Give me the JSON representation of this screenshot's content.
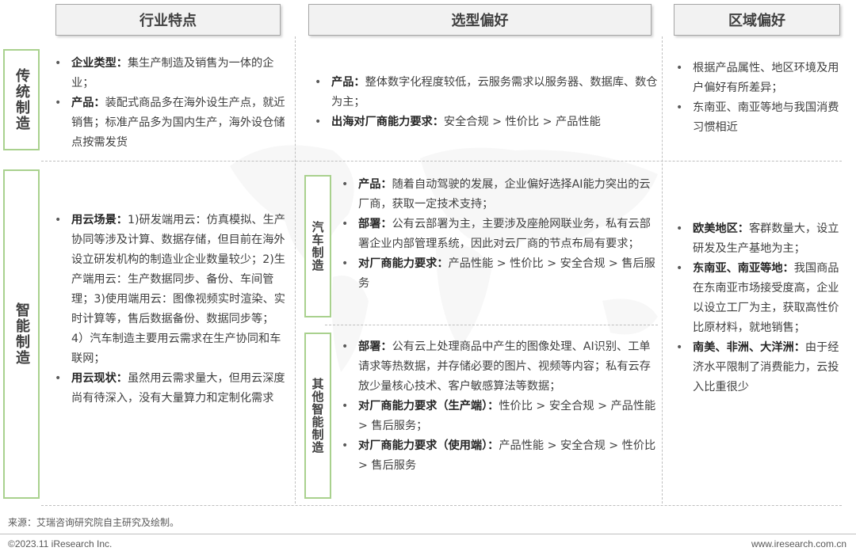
{
  "columns": {
    "industry": "行业特点",
    "preference": "选型偏好",
    "region": "区域偏好"
  },
  "rows": {
    "traditional": "传统制造",
    "smart": "智能制造"
  },
  "sub_rows": {
    "auto": "汽车制造",
    "other": "其他智能制造"
  },
  "traditional": {
    "industry": [
      {
        "label": "企业类型：",
        "text": "集生产制造及销售为一体的企业；"
      },
      {
        "label": "产品：",
        "text": "装配式商品多在海外设生产点，就近销售；标准产品多为国内生产，海外设仓储点按需发货"
      }
    ],
    "preference": [
      {
        "label": "产品：",
        "text": "整体数字化程度较低，云服务需求以服务器、数据库、数仓为主；"
      },
      {
        "label": "出海对厂商能力要求：",
        "text": "安全合规 > 性价比 > 产品性能"
      }
    ],
    "region": [
      {
        "text": "根据产品属性、地区环境及用户偏好有所差异；"
      },
      {
        "text": "东南亚、南亚等地与我国消费习惯相近"
      }
    ]
  },
  "smart": {
    "industry": [
      {
        "label": "用云场景：",
        "text": "1)研发端用云：仿真模拟、生产协同等涉及计算、数据存储，但目前在海外设立研发机构的制造业企业数量较少；2)生产端用云：生产数据同步、备份、车间管理；3)使用端用云：图像视频实时渲染、实时计算等，售后数据备份、数据同步等；4）汽车制造主要用云需求在生产协同和车联网；"
      },
      {
        "label": "用云现状：",
        "text": "虽然用云需求量大，但用云深度尚有待深入，没有大量算力和定制化需求"
      }
    ],
    "auto_preference": [
      {
        "label": "产品：",
        "text": "随着自动驾驶的发展，企业偏好选择AI能力突出的云厂商，获取一定技术支持；"
      },
      {
        "label": "部署：",
        "text": "公有云部署为主，主要涉及座舱网联业务，私有云部署企业内部管理系统，因此对云厂商的节点布局有要求；"
      },
      {
        "label": "对厂商能力要求：",
        "text": "产品性能 > 性价比 > 安全合规 > 售后服务"
      }
    ],
    "other_preference": [
      {
        "label": "部署：",
        "text": "公有云上处理商品中产生的图像处理、AI识别、工单请求等热数据，并存储必要的图片、视频等内容；私有云存放少量核心技术、客户敏感算法等数据；"
      },
      {
        "label": "对厂商能力要求（生产端）：",
        "text": "性价比 > 安全合规 > 产品性能 > 售后服务；"
      },
      {
        "label": "对厂商能力要求（使用端）：",
        "text": "产品性能 > 安全合规 > 性价比 > 售后服务"
      }
    ],
    "region": [
      {
        "label": "欧美地区：",
        "text": "客群数量大，设立研发及生产基地为主；"
      },
      {
        "label": "东南亚、南亚等地：",
        "text": "我国商品在东南亚市场接受度高，企业以设立工厂为主，获取高性价比原材料，就地销售；"
      },
      {
        "label": "南美、非洲、大洋洲：",
        "text": "由于经济水平限制了消费能力，云投入比重很少"
      }
    ]
  },
  "footer": {
    "source": "来源：艾瑞咨询研究院自主研究及绘制。",
    "copyright": "©2023.11 iResearch Inc.",
    "website": "www.iresearch.com.cn"
  },
  "colors": {
    "label_border": "#a9d18e",
    "header_bg": "#f2f2f2",
    "text": "#404040"
  }
}
